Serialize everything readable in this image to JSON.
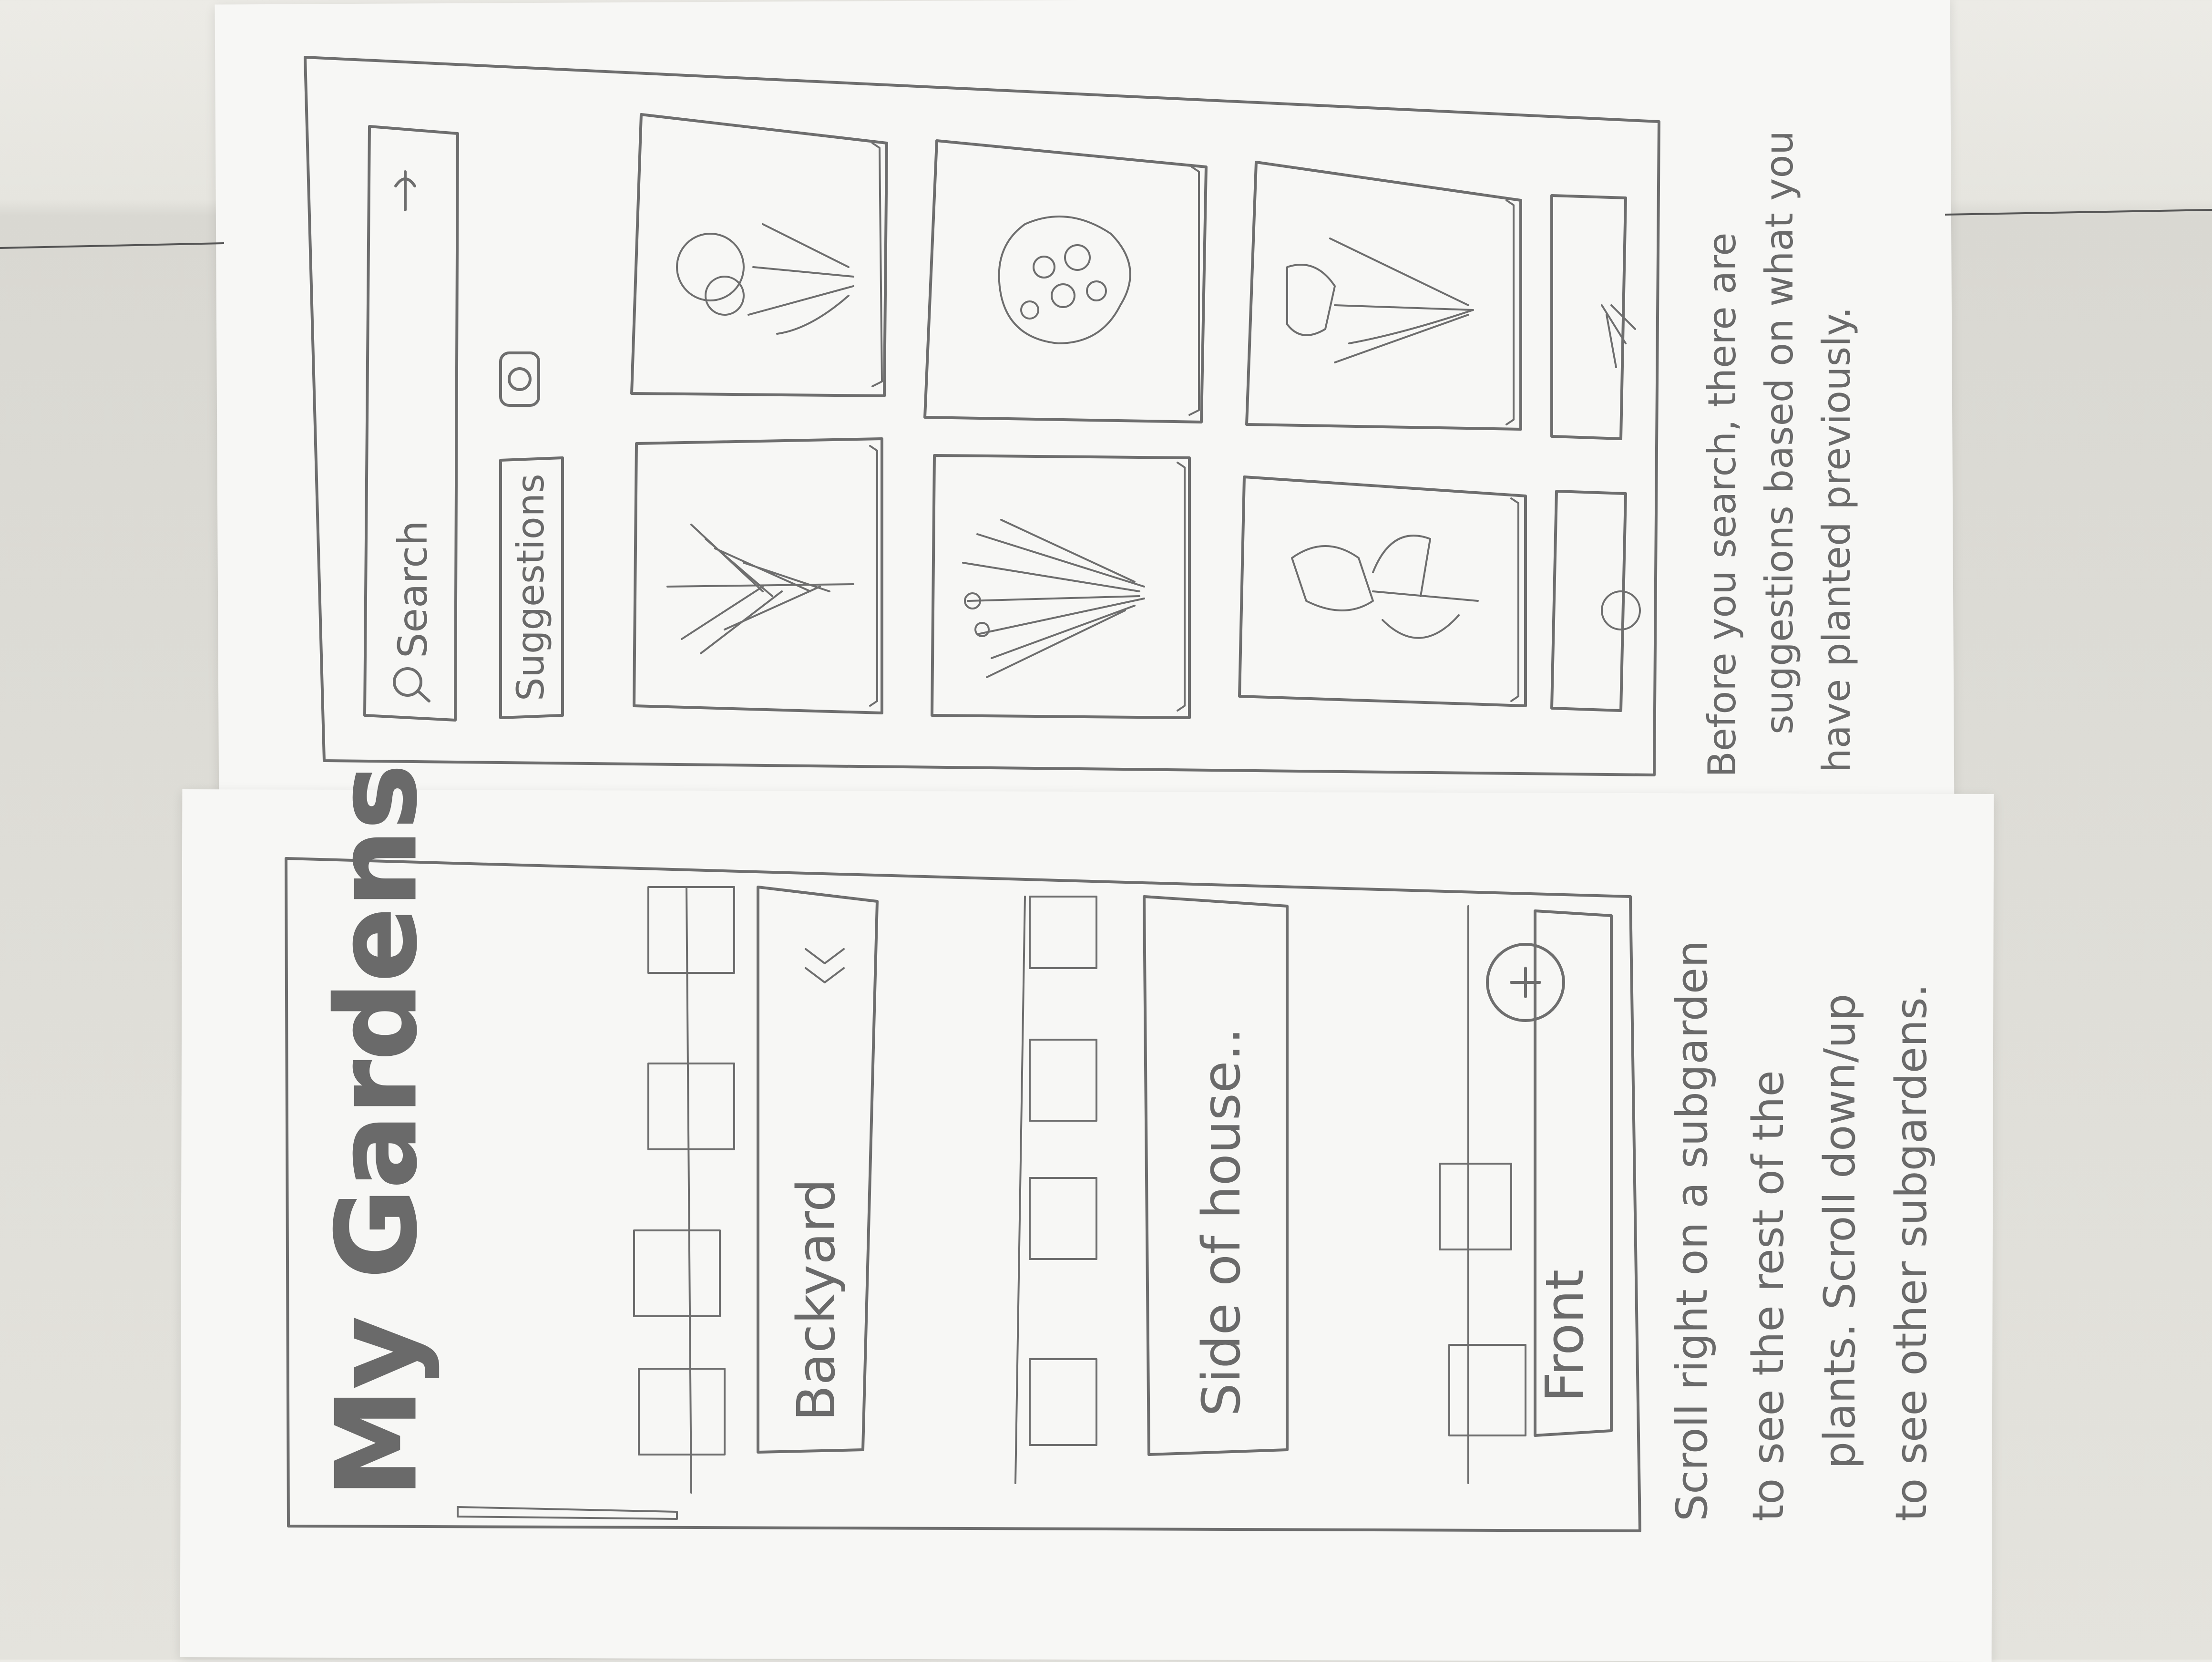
{
  "search_screen": {
    "search_placeholder": "Search",
    "suggestions_label": "Suggestions",
    "plant_cards": [
      {
        "name": "plant-card-flower-1"
      },
      {
        "name": "plant-card-shrub"
      },
      {
        "name": "plant-card-tulip"
      },
      {
        "name": "plant-card-grass-small"
      },
      {
        "name": "plant-card-fern"
      },
      {
        "name": "plant-card-grass"
      },
      {
        "name": "plant-card-lily"
      },
      {
        "name": "plant-card-flower-2"
      }
    ],
    "annotation": [
      "Before you search, there are",
      "suggestions based on what you",
      "have planted previously."
    ]
  },
  "gardens_screen": {
    "title": "My Gardens",
    "gardens": [
      {
        "label": "Backyard"
      },
      {
        "label": "Side of house.."
      },
      {
        "label": "Front"
      }
    ],
    "add_symbol": "+",
    "annotation": [
      "Scroll right on a subgarden",
      "to see the rest of the",
      "plants. Scroll down/up",
      "to see other subgardens."
    ]
  },
  "icons": [
    "search-icon",
    "mic-icon",
    "camera-icon",
    "chevron-right-icon",
    "plus-icon"
  ]
}
